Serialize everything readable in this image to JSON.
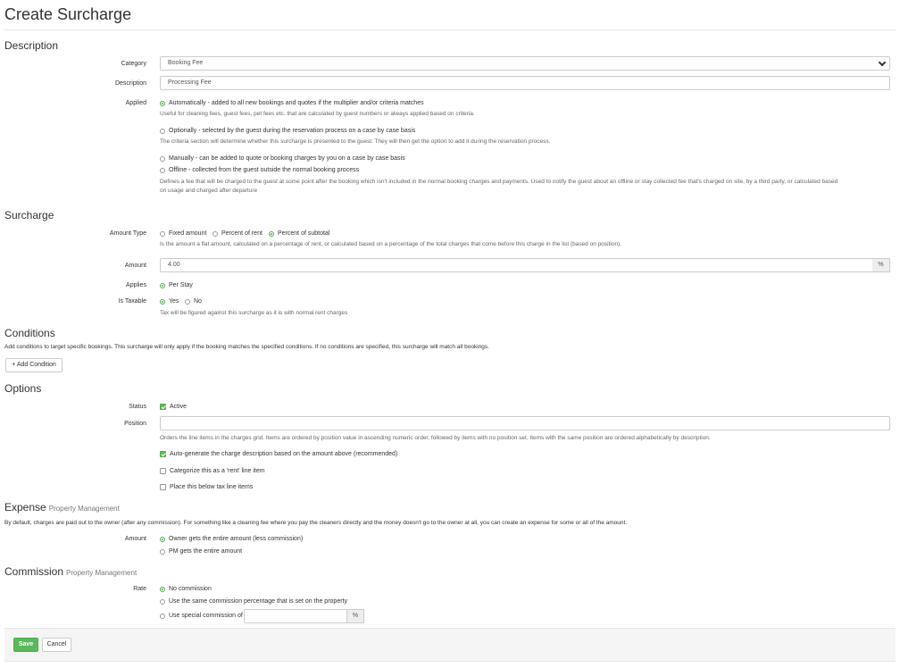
{
  "page": {
    "title": "Create Surcharge"
  },
  "description_section": {
    "heading": "Description",
    "category": {
      "label": "Category",
      "value": "Booking Fee"
    },
    "description": {
      "label": "Description",
      "value": "Processing Fee"
    },
    "applied": {
      "label": "Applied",
      "options": [
        {
          "label": "Automatically - added to all new bookings and quotes if the multiplier and/or criteria matches",
          "help": "Useful for cleaning fees, guest fees, pet fees etc. that are calculated by guest numbers or always applied based on criteria.",
          "selected": true
        },
        {
          "label": "Optionally - selected by the guest during the reservation process on a case by case basis",
          "help": "The criteria section will determine whether this surcharge is presented to the guest. They will then get the option to add it during the reservation process.",
          "selected": false
        },
        {
          "label": "Manually - can be added to quote or booking charges by you on a case by case basis",
          "help": "",
          "selected": false
        },
        {
          "label": "Offline - collected from the guest outside the normal booking process",
          "help": "Defines a fee that will be charged to the guest at some point after the booking which isn't included in the normal booking charges and payments. Used to notify the guest about an offline or stay collected fee that's charged on site, by a third party, or calculated based",
          "help2": "on usage and charged after departure",
          "selected": false
        }
      ]
    }
  },
  "surcharge_section": {
    "heading": "Surcharge",
    "amount_type": {
      "label": "Amount Type",
      "options": [
        "Fixed amount",
        "Percent of rent",
        "Percent of subtotal"
      ],
      "selected_index": 2,
      "help": "Is the amount a flat amount, calculated on a percentage of rent, or calculated based on a percentage of the total charges that come before this charge in the list (based on position)."
    },
    "amount": {
      "label": "Amount",
      "value": "4.00",
      "unit": "%"
    },
    "applies": {
      "label": "Applies",
      "option": "Per Stay"
    },
    "is_taxable": {
      "label": "Is Taxable",
      "options": [
        "Yes",
        "No"
      ],
      "selected_index": 0,
      "help": "Tax will be figured against this surcharge as it is with normal rent charges"
    }
  },
  "conditions_section": {
    "heading": "Conditions",
    "help": "Add conditions to target specific bookings. This surcharge will only apply if the booking matches the specified conditions. If no conditions are specified, this surcharge will match all bookings.",
    "add_button": "+ Add Condition"
  },
  "options_section": {
    "heading": "Options",
    "status": {
      "label": "Status",
      "option": "Active",
      "checked": true
    },
    "position": {
      "label": "Position",
      "value": "",
      "help": "Orders the line items in the charges grid. Items are ordered by position value in ascending numeric order, followed by items with no position set. Items with the same position are ordered alphabetically by description."
    },
    "checkboxes": [
      {
        "label": "Auto-generate the charge description based on the amount above (recommended)",
        "checked": true
      },
      {
        "label": "Categorize this as a 'rent' line item",
        "checked": false
      },
      {
        "label": "Place this below tax line items",
        "checked": false
      }
    ]
  },
  "expense_section": {
    "heading": "Expense",
    "subheading": "Property Management",
    "help": "By default, charges are paid out to the owner (after any commission). For something like a cleaning fee where you pay the cleaners directly and the money doesn't go to the owner at all, you can create an expense for some or all of the amount.",
    "amount": {
      "label": "Amount",
      "options": [
        "Owner gets the entire amount (less commission)",
        "PM gets the entire amount"
      ],
      "selected_index": 0
    }
  },
  "commission_section": {
    "heading": "Commission",
    "subheading": "Property Management",
    "rate": {
      "label": "Rate",
      "options": [
        "No commission",
        "Use the same commission percentage that is set on the property",
        "Use special commission of"
      ],
      "selected_index": 0,
      "special_value": "",
      "unit": "%"
    }
  },
  "footer": {
    "save": "Save",
    "cancel": "Cancel"
  },
  "colors": {
    "accent": "#5cb85c",
    "border": "#cccccc",
    "text": "#333333"
  }
}
